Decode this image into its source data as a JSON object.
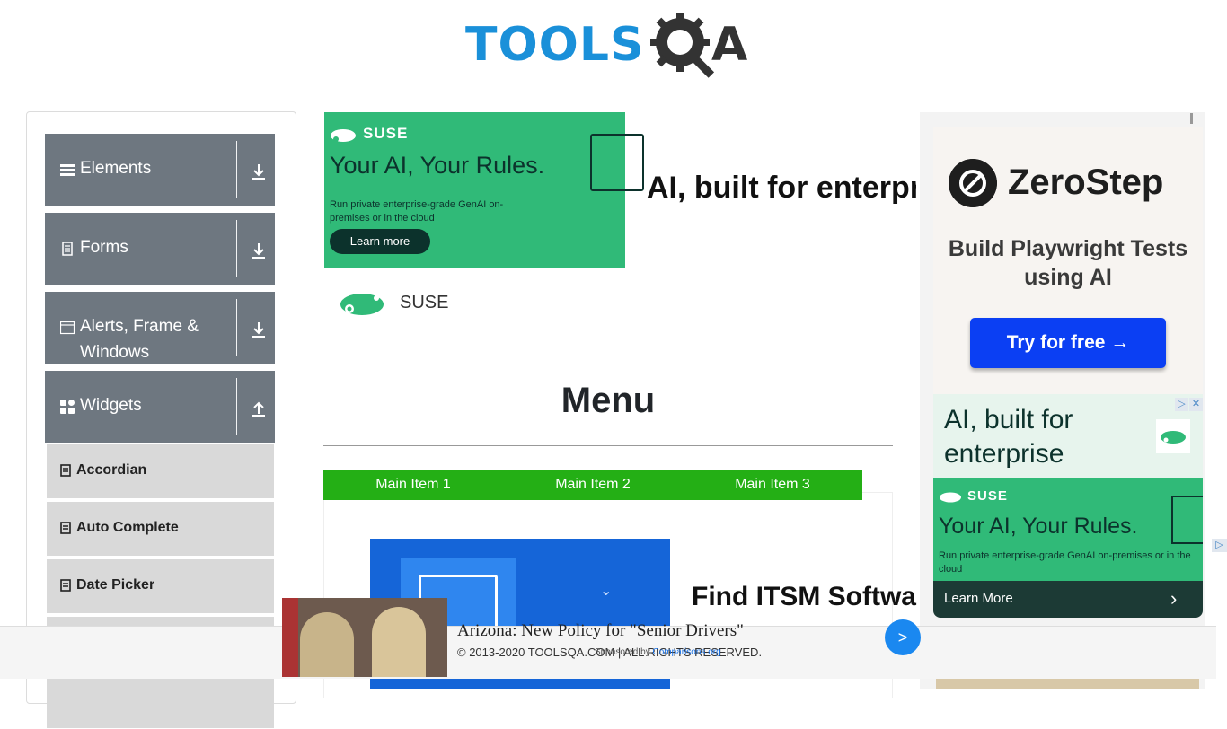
{
  "header": {
    "logo_text": "TOOLS",
    "logo_suffix": "A"
  },
  "sidebar": {
    "groups": [
      {
        "label": "Elements",
        "icon": "hamburger-icon",
        "expanded": false
      },
      {
        "label": "Forms",
        "icon": "document-icon",
        "expanded": false
      },
      {
        "label": "Alerts, Frame & Windows",
        "icon": "window-icon",
        "expanded": false
      },
      {
        "label": "Widgets",
        "icon": "widgets-icon",
        "expanded": true
      }
    ],
    "widget_items": [
      {
        "label": "Accordian"
      },
      {
        "label": "Auto Complete"
      },
      {
        "label": "Date Picker"
      }
    ]
  },
  "ads": {
    "suse_brand": "SUSE",
    "suse_headline": "Your AI, Your Rules.",
    "suse_sub": "Run private enterprise-grade GenAI on-premises or in the cloud",
    "suse_button": "Learn more",
    "ai_heading": "AI, built for enterpr",
    "suse_row_label": "SUSE",
    "blue_heading": "Find ITSM Softwa",
    "zerostep_name": "ZeroStep",
    "zerostep_tagline": "Build Playwright Tests using AI",
    "zerostep_button": "Try for free →",
    "ai_box_text": "AI, built for enterprise",
    "adchoice_1": "▷",
    "adchoice_2": "✕",
    "suse2_brand": "SUSE",
    "suse2_headline": "Your AI, Your Rules.",
    "suse2_sub": "Run private enterprise-grade GenAI on-premises or in the cloud",
    "learn_more": "Learn More",
    "learn_chevron": "›",
    "side_adchoice": "▷"
  },
  "main": {
    "menu_title": "Menu",
    "menu_items": [
      "Main Item 1",
      "Main Item 2",
      "Main Item 3"
    ]
  },
  "bottom_ad": {
    "headline": "Arizona: New Policy for \"Senior Drivers\"",
    "sponsored_prefix": "Sponsored by",
    "sponsor": "Comparisons.org",
    "next": ">"
  },
  "footer": {
    "copyright": "© 2013-2020 TOOLSQA.COM | ALL RIGHTS RESERVED."
  },
  "colors": {
    "sidebar_group_bg": "#6e7780",
    "sidebar_item_bg": "#d9d9d9",
    "menu_bar": "#24af15",
    "suse_green": "#30ba78",
    "zerostep_button": "#0b3ff3"
  }
}
